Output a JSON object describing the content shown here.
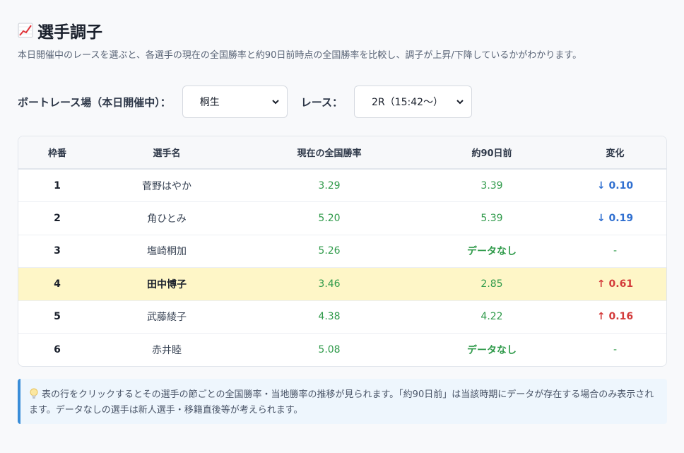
{
  "header": {
    "title": "選手調子",
    "description": "本日開催中のレースを選ぶと、各選手の現在の全国勝率と約90日前時点の全国勝率を比較し、調子が上昇/下降しているかがわかります。"
  },
  "controls": {
    "venue_label": "ボートレース場（本日開催中）：",
    "venue_value": "桐生",
    "race_label": "レース：",
    "race_value": "2R（15:42〜）"
  },
  "table": {
    "columns": [
      "枠番",
      "選手名",
      "現在の全国勝率",
      "約90日前",
      "変化"
    ],
    "rows": [
      {
        "frame": "1",
        "name": "菅野はやか",
        "current": "3.29",
        "past": "3.39",
        "change": "↓ 0.10",
        "trend": "down"
      },
      {
        "frame": "2",
        "name": "角ひとみ",
        "current": "5.20",
        "past": "5.39",
        "change": "↓ 0.19",
        "trend": "down"
      },
      {
        "frame": "3",
        "name": "塩崎桐加",
        "current": "5.26",
        "past": "データなし",
        "change": "-",
        "trend": "none"
      },
      {
        "frame": "4",
        "name": "田中博子",
        "current": "3.46",
        "past": "2.85",
        "change": "↑ 0.61",
        "trend": "up",
        "highlight": true
      },
      {
        "frame": "5",
        "name": "武藤綾子",
        "current": "4.38",
        "past": "4.22",
        "change": "↑ 0.16",
        "trend": "up"
      },
      {
        "frame": "6",
        "name": "赤井睦",
        "current": "5.08",
        "past": "データなし",
        "change": "-",
        "trend": "none"
      }
    ]
  },
  "note": {
    "icon": "lightbulb-icon",
    "text": "表の行をクリックするとその選手の節ごとの全国勝率・当地勝率の推移が見られます。「約90日前」は当該時期にデータが存在する場合のみ表示されます。データなしの選手は新人選手・移籍直後等が考えられます。"
  },
  "colors": {
    "up": "#d33a3a",
    "down": "#2f6fd0",
    "rate": "#2f9a4a",
    "highlight_row": "#fef6c7",
    "note_border": "#3a8dd8"
  }
}
